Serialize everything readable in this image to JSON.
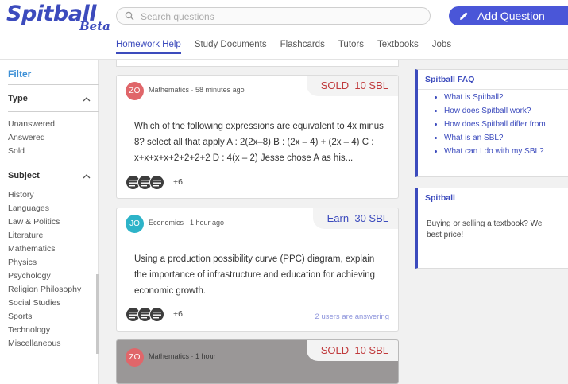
{
  "header": {
    "logo_main": "Spitball",
    "logo_sub": "Beta",
    "search_placeholder": "Search questions",
    "add_button_label": "Add Question"
  },
  "nav": {
    "tabs": [
      {
        "label": "Homework Help",
        "active": true
      },
      {
        "label": "Study Documents",
        "active": false
      },
      {
        "label": "Flashcards",
        "active": false
      },
      {
        "label": "Tutors",
        "active": false
      },
      {
        "label": "Textbooks",
        "active": false
      },
      {
        "label": "Jobs",
        "active": false
      }
    ]
  },
  "sidebar": {
    "filter_label": "Filter",
    "type_title": "Type",
    "type_options": [
      "Unanswered",
      "Answered",
      "Sold"
    ],
    "subject_title": "Subject",
    "subjects": [
      "History",
      "Languages",
      "Law & Politics",
      "Literature",
      "Mathematics",
      "Physics",
      "Psychology",
      "Religion Philosophy",
      "Social Studies",
      "Sports",
      "Technology",
      "Miscellaneous"
    ]
  },
  "questions": [
    {
      "initials": "ZO",
      "avatar_color": "#e0666a",
      "subject": "Mathematics",
      "time": "58 minutes ago",
      "badge_kind": "sold",
      "badge_label": "SOLD",
      "badge_value": "10 SBL",
      "text": "Which of the following expressions are equivalent to 4x minus 8? select all that apply A : 2(2x–8) B : (2x – 4) + (2x – 4) C : x+x+x+x+2+2+2+2 D : 4(x – 2) Jesse chose A as his...",
      "more_answers": "+6",
      "answering": ""
    },
    {
      "initials": "JO",
      "avatar_color": "#2db3c8",
      "subject": "Economics",
      "time": "1 hour ago",
      "badge_kind": "earn",
      "badge_label": "Earn",
      "badge_value": "30 SBL",
      "text": "Using a production possibility curve (PPC) diagram, explain the importance of infrastructure and education for achieving economic growth.",
      "more_answers": "+6",
      "answering": "2 users are answering"
    },
    {
      "initials": "ZO",
      "avatar_color": "#e0666a",
      "subject": "Mathematics",
      "time": "1 hour",
      "badge_kind": "sold",
      "badge_label": "SOLD",
      "badge_value": "10 SBL"
    }
  ],
  "faq": {
    "title": "Spitball FAQ",
    "items": [
      "What is Spitball?",
      "How does Spitball work?",
      "How does Spitball differ from",
      "What is an SBL?",
      "What can I do with my SBL?"
    ]
  },
  "promo": {
    "title": "Spitball",
    "text": "Buying or selling a textbook? We best price!"
  },
  "colors": {
    "brand": "#3c4bbd",
    "sold": "#c0393b",
    "accent_link": "#3c8fd6"
  }
}
